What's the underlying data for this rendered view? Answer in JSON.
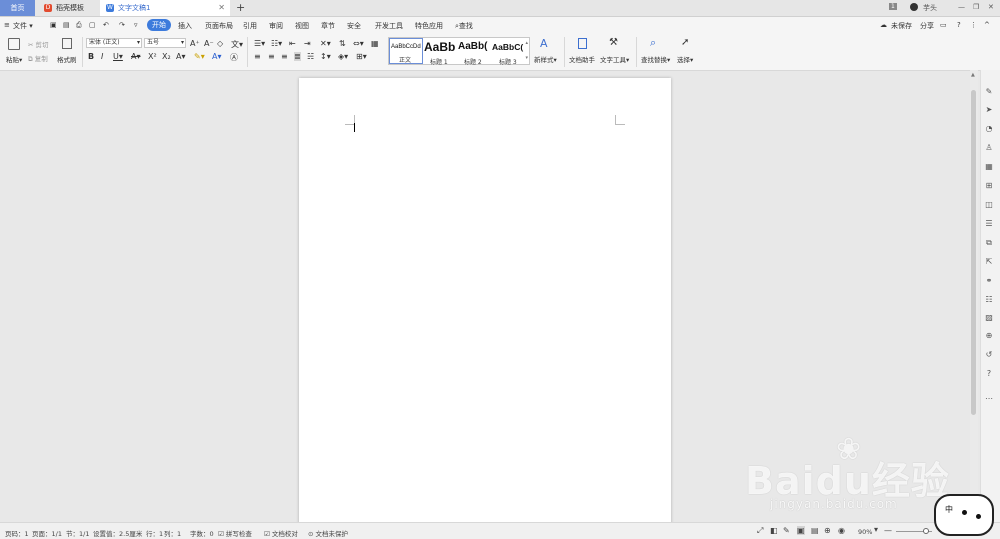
{
  "tabs": [
    {
      "label": "首页"
    },
    {
      "label": "稻壳模板"
    },
    {
      "label": "文字文稿1"
    }
  ],
  "window": {
    "badge": "1",
    "user": "芋头"
  },
  "menu": {
    "file": "文件",
    "items": [
      "开始",
      "插入",
      "页面布局",
      "引用",
      "审阅",
      "视图",
      "章节",
      "安全",
      "开发工具",
      "特色应用"
    ],
    "search": "查找",
    "unsaved": "未保存",
    "share": "分享"
  },
  "ribbon": {
    "paste": "粘贴",
    "cut": "剪切",
    "copy": "复制",
    "format_painter": "格式刷",
    "font_name": "宋体 (正文)",
    "font_size": "五号",
    "styles": [
      {
        "sample": "AaBbCcDd",
        "label": "正文"
      },
      {
        "sample": "AaBb",
        "label": "标题 1"
      },
      {
        "sample": "AaBb(",
        "label": "标题 2"
      },
      {
        "sample": "AaBbC(",
        "label": "标题 3"
      }
    ],
    "new_style": "新样式",
    "doc_helper": "文档助手",
    "text_tools": "文字工具",
    "find_replace": "查找替换",
    "select": "选择"
  },
  "status": {
    "page_num": "页码：1",
    "pages": "页面：1/1",
    "section": "节：1/1",
    "setting": "设置值：2.5厘米",
    "row": "行：1",
    "col": "列：1",
    "words": "字数：0",
    "spell": "拼写检查",
    "proof": "文档校对",
    "protect": "文档未保护",
    "zoom": "90%"
  },
  "watermark": {
    "main": "Baidu经验",
    "sub": "jingyan.baidu.com"
  },
  "ime": "中"
}
